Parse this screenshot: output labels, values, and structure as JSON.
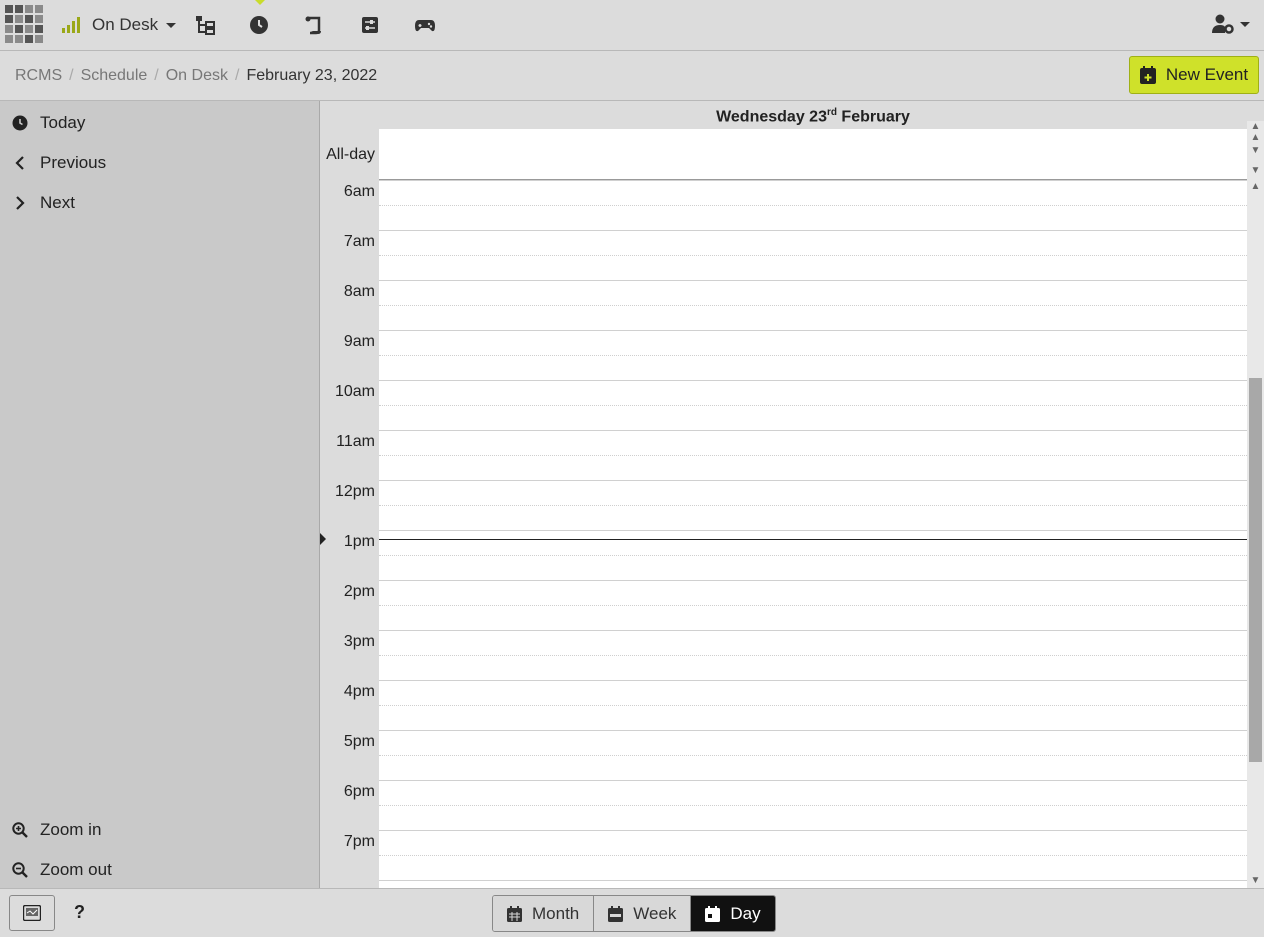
{
  "topbar": {
    "desk_label": "On Desk"
  },
  "breadcrumb": {
    "items": [
      "RCMS",
      "Schedule",
      "On Desk"
    ],
    "current": "February 23, 2022"
  },
  "actions": {
    "new_event_label": "New Event"
  },
  "sidebar": {
    "today": "Today",
    "previous": "Previous",
    "next": "Next",
    "zoom_in": "Zoom in",
    "zoom_out": "Zoom out"
  },
  "calendar": {
    "day_name": "Wednesday 23",
    "day_suffix": "rd",
    "month": "February",
    "allday_label": "All-day",
    "hours": [
      "6am",
      "7am",
      "8am",
      "9am",
      "10am",
      "11am",
      "12pm",
      "1pm",
      "2pm",
      "3pm",
      "4pm",
      "5pm",
      "6pm",
      "7pm"
    ]
  },
  "bottombar": {
    "help": "?",
    "views": [
      "Month",
      "Week",
      "Day"
    ],
    "active_view": "Day"
  },
  "colors": {
    "accent": "#cfe12a",
    "background": "#dcdcdc",
    "sidebar": "#c9c9c9"
  }
}
